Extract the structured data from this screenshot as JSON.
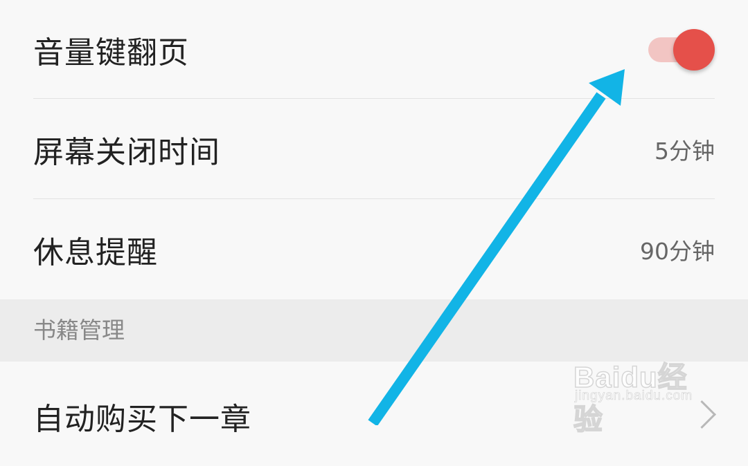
{
  "colors": {
    "accent": "#e5504a",
    "arrow": "#12b4e6",
    "section_bg": "#ececec",
    "page_bg": "#f8f8f8"
  },
  "settings": [
    {
      "label": "音量键翻页",
      "control": "toggle",
      "checked": true
    },
    {
      "label": "屏幕关闭时间",
      "value": "5分钟"
    },
    {
      "label": "休息提醒",
      "value": "90分钟"
    }
  ],
  "section": {
    "title": "书籍管理"
  },
  "book_settings": [
    {
      "label": "自动购买下一章"
    }
  ],
  "watermark": {
    "brand": "Baidu经验",
    "site": "jingyan.baidu.com"
  }
}
